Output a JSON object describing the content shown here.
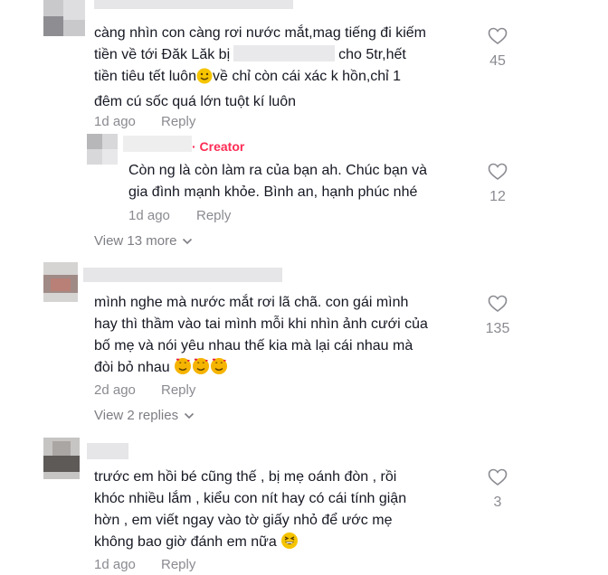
{
  "comments": [
    {
      "lines": [
        "càng nhìn con càng rơi nước mắt,mag tiếng đi kiếm",
        "tiền về tới Đăk Lăk bị",
        "cho 5tr,hết",
        "tiền tiêu tết luôn",
        "về chỉ còn cái xác k hồn,chỉ 1",
        "đêm cú sốc quá lớn tuột kí luôn"
      ],
      "time": "1d ago",
      "reply_label": "Reply",
      "likes": "45"
    },
    {
      "badge": "· Creator",
      "lines": [
        "Còn ng là còn làm ra của bạn ah. Chúc bạn và",
        "gia đình mạnh khỏe. Bình an, hạnh phúc nhé"
      ],
      "time": "1d ago",
      "reply_label": "Reply",
      "likes": "12"
    },
    {
      "lines": [
        "mình nghe mà nước mắt rơi lã chã. con gái mình",
        "hay thì thầm vào tai mình mỗi khi nhìn ảnh cưới của",
        "bố mẹ và nói yêu nhau thế kia mà lại cái nhau mà",
        "đòi bỏ nhau"
      ],
      "time": "2d ago",
      "reply_label": "Reply",
      "likes": "135"
    },
    {
      "lines": [
        "trước em hồi bé cũng thế , bị mẹ oánh đòn , rồi",
        "khóc nhiều lắm , kiểu con nít hay có cái tính giận",
        "hờn , em viết ngay vào tờ giấy nhỏ để ước mẹ",
        "không bao giờ đánh em nữa"
      ],
      "time": "1d ago",
      "reply_label": "Reply",
      "likes": "3"
    }
  ],
  "view_more": {
    "first": "View 13 more",
    "second": "View 2 replies"
  },
  "colors": {
    "text": "#161823",
    "meta": "#8a8b91",
    "creator": "#fe2c55"
  },
  "icons": {
    "like": "heart-outline-icon",
    "expand": "chevron-down-icon",
    "smile": "smiling-face-emoji",
    "heart_eyes": "smiling-face-with-hearts-emoji",
    "grin": "grinning-squinting-face-emoji"
  }
}
